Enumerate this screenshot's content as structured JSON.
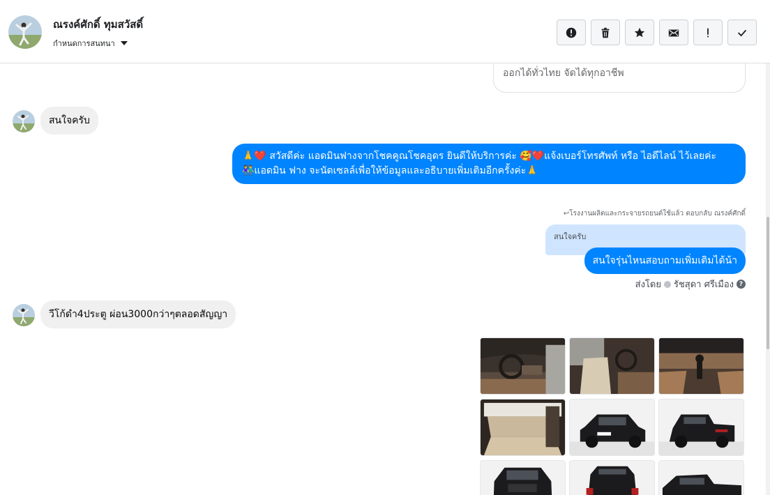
{
  "header": {
    "name": "ณรงค์ศักดิ์ ทุมสวัสดิ์",
    "subtitle": "กำหนดการสนทนา",
    "actions": [
      {
        "name": "report-icon"
      },
      {
        "name": "trash-icon"
      },
      {
        "name": "star-icon"
      },
      {
        "name": "envelope-icon"
      },
      {
        "name": "exclamation-icon"
      },
      {
        "name": "check-icon"
      }
    ]
  },
  "conversation": {
    "previous_card_text": "ออกได้ทั่วไทย จัดได้ทุกอาชีพ",
    "messages": {
      "m1": "สนใจครับ",
      "m2_line1": "🙏❤️ สวัสดีค่ะ แอดมินฟางจากโชคคูณโชคอุดร ยินดีให้บริการค่ะ 🥰❤️แจ้งเบอร์โทรศัพท์ หรือ ไอดีไลน์ ไว้เลยค่ะ",
      "m2_line2": "👫แอดมิน ฟาง จะนัดเซลล์เพื่อให้ข้อมูลและอธิบายเพิ่มเติมอีกครั้งค่ะ🙏",
      "reply_note": "↩โรงงานผลิตและกระจายรถยนต์ใช้แล้ว ตอบกลับ ณรงค์ศักดิ์",
      "quoted": "สนใจครับ",
      "m3": "สนใจรุ่นไหนสอบถามเพิ่มเติมได้น้า",
      "sent_by_prefix": "ส่งโดย",
      "sent_by_name": "รัชสุดา ศรีเมือง",
      "m4": "วีโก้ดำ4ประตู ผ่อน3000กว่าๆตลอดสัญญา"
    },
    "photos": [
      {
        "name": "photo-interior-dashboard"
      },
      {
        "name": "photo-interior-seats"
      },
      {
        "name": "photo-interior-gearshift"
      },
      {
        "name": "photo-rear-seats"
      },
      {
        "name": "photo-truck-front"
      },
      {
        "name": "photo-truck-rear"
      },
      {
        "name": "photo-truck-front-2"
      },
      {
        "name": "photo-truck-back"
      },
      {
        "name": "photo-truck-side"
      }
    ]
  },
  "colors": {
    "accent": "#0084ff",
    "incoming_bubble": "#f0f0f0",
    "quoted_bubble": "#cfe4ff"
  }
}
